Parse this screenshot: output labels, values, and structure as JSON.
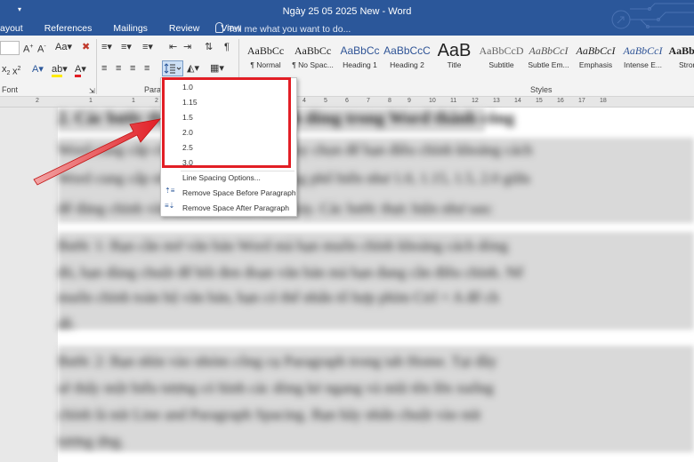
{
  "title_bar": {
    "document_title": "Ngày 25 05 2025 New - Word",
    "tabs": [
      "ayout",
      "References",
      "Mailings",
      "Review",
      "View"
    ],
    "tell_me_placeholder": "Tell me what you want to do..."
  },
  "ribbon": {
    "group_labels": {
      "font": "Font",
      "paragraph": "Parag",
      "styles": "Styles"
    },
    "styles": [
      {
        "preview": "AaBbCc",
        "label": "¶ Normal"
      },
      {
        "preview": "AaBbCc",
        "label": "¶ No Spac..."
      },
      {
        "preview": "AaBbCc",
        "label": "Heading 1"
      },
      {
        "preview": "AaBbCcC",
        "label": "Heading 2"
      },
      {
        "preview": "AaB",
        "label": "Title"
      },
      {
        "preview": "AaBbCcD",
        "label": "Subtitle"
      },
      {
        "preview": "AaBbCcI",
        "label": "Subtle Em..."
      },
      {
        "preview": "AaBbCcI",
        "label": "Emphasis"
      },
      {
        "preview": "AaBbCcI",
        "label": "Intense E..."
      },
      {
        "preview": "AaBbCcI",
        "label": "Strong"
      }
    ]
  },
  "line_spacing_menu": {
    "options": [
      "1.0",
      "1.15",
      "1.5",
      "2.0",
      "2.5",
      "3.0"
    ],
    "line_spacing_options": "Line Spacing Options...",
    "remove_before": "Remove Space Before Paragraph",
    "remove_after": "Remove Space After Paragraph"
  },
  "highlight_color": "#e21e25",
  "accent_color": "#2b579a",
  "document_blurred": {
    "heading": "2. Các bước thay đổi khoảng cách dòng trong Word thành công",
    "lines": [
      "Word cung cấp cho người dùng nhiều tùy chọn để bạn điều chỉnh khoảng cách",
      "Word cung cấp nhiều lựa chọn giãn dòng phổ biến như 1.0, 1.15, 1.5, 2.0 giữa",
      "để đảng chỉnh văn bản theo cách trình bày. Các bước thực hiện như sau:",
      "Bước 1: Bạn cần mở văn bản Word mà bạn muốn chỉnh khoảng cách dòng",
      "đó, bạn dùng chuột để bôi đen đoạn văn bản mà bạn đang cần điều chỉnh. Nế",
      "muốn chỉnh toàn bộ văn bản, bạn có thể nhấn tổ hợp phím Ctrl + A để ch",
      "dề.",
      "Bước 2: Bạn nhìn vào nhóm công cụ Paragraph trong tab Home. Tại đây",
      "sẽ thấy một biểu tượng có hình các dòng kẻ ngang và mũi tên lên xuống",
      "chính là nút Line and Paragraph Spacing. Bạn hãy nhấn chuột vào nút",
      "tương ứng."
    ]
  },
  "ruler_numbers": [
    "2",
    "1",
    "1",
    "2",
    "3",
    "4",
    "5",
    "6",
    "7",
    "8",
    "9",
    "10",
    "11",
    "12",
    "13",
    "14",
    "15",
    "16",
    "17",
    "18"
  ]
}
